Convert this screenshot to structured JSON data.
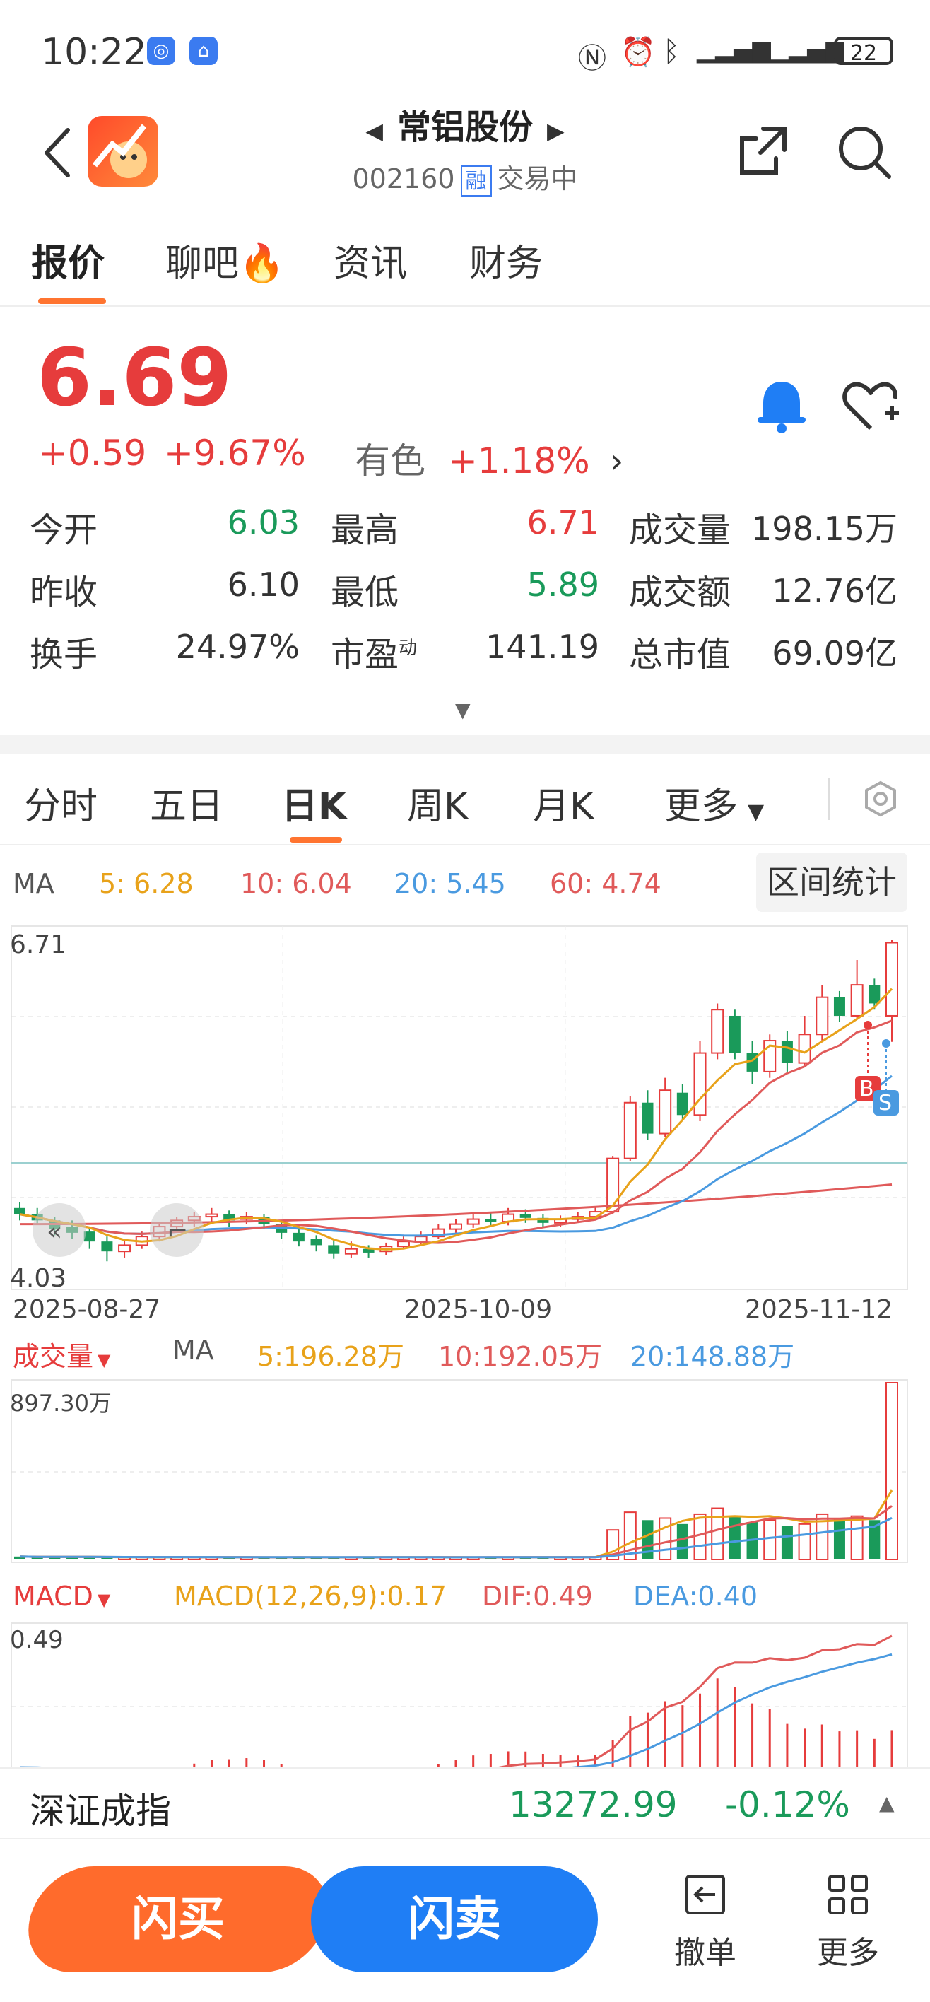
{
  "status_bar": {
    "time": "10:22",
    "battery": "22"
  },
  "header": {
    "title": "常铝股份",
    "code": "002160",
    "rong": "融",
    "status": "交易中"
  },
  "main_tabs": [
    {
      "label": "报价"
    },
    {
      "label": "聊吧"
    },
    {
      "label": "资讯"
    },
    {
      "label": "财务"
    }
  ],
  "quote": {
    "price": "6.69",
    "change": "+0.59",
    "change_pct": "+9.67%",
    "sector_name": "有色",
    "sector_pct": "+1.18%",
    "rows": [
      [
        {
          "label": "今开",
          "value": "6.03",
          "color": "green"
        },
        {
          "label": "最高",
          "value": "6.71",
          "color": "red"
        },
        {
          "label": "成交量",
          "value": "198.15万",
          "color": "dark"
        }
      ],
      [
        {
          "label": "昨收",
          "value": "6.10",
          "color": "dark"
        },
        {
          "label": "最低",
          "value": "5.89",
          "color": "green"
        },
        {
          "label": "成交额",
          "value": "12.76亿",
          "color": "dark"
        }
      ],
      [
        {
          "label": "换手",
          "value": "24.97%",
          "color": "dark"
        },
        {
          "label": "市盈",
          "sup": "动",
          "value": "141.19",
          "color": "dark"
        },
        {
          "label": "总市值",
          "value": "69.09亿",
          "color": "dark"
        }
      ]
    ]
  },
  "chart_tabs": [
    {
      "label": "分时"
    },
    {
      "label": "五日"
    },
    {
      "label": "日K"
    },
    {
      "label": "周K"
    },
    {
      "label": "月K"
    },
    {
      "label": "更多"
    }
  ],
  "ma_legend": {
    "ma": "MA",
    "ma5": "5:  6.28",
    "ma10": "10:  6.04",
    "ma20": "20:  5.45",
    "ma60": "60:  4.74"
  },
  "interval_stats": "区间统计",
  "kline": {
    "top_label": "6.71",
    "bottom_label": "4.03",
    "dates": [
      "2025-08-27",
      "2025-10-09",
      "2025-11-12"
    ],
    "marker_b": "B",
    "marker_s": "S"
  },
  "volume_legend": {
    "label": "成交量",
    "ma": "MA",
    "ma5": "5:196.28万",
    "ma10": "10:192.05万",
    "ma20": "20:148.88万",
    "top_label": "897.30万"
  },
  "macd_legend": {
    "label": "MACD",
    "macd": "MACD(12,26,9):0.17",
    "dif": "DIF:0.49",
    "dea": "DEA:0.40",
    "top_label": "0.49"
  },
  "index_bar": {
    "name": "深证成指",
    "value": "13272.99",
    "pct": "-0.12%"
  },
  "actions": {
    "buy": "闪买",
    "sell": "闪卖",
    "cancel": "撤单",
    "more": "更多"
  },
  "colors": {
    "up": "#e63c3c",
    "down": "#1a9a5a",
    "accent": "#ff7430",
    "blue": "#1f7ef5",
    "ma5": "#e8a21a",
    "ma10": "#e05a5a",
    "ma20": "#4a9ae0",
    "ma60": "#e05a5a"
  },
  "chart_data": [
    {
      "type": "candlestick",
      "title": "日K",
      "x_labels": [
        "2025-08-27",
        "2025-10-09",
        "2025-11-12"
      ],
      "ylim": [
        4.03,
        6.71
      ],
      "candles": [
        [
          4.55,
          4.5,
          4.6,
          4.45
        ],
        [
          4.5,
          4.45,
          4.55,
          4.42
        ],
        [
          4.45,
          4.38,
          4.48,
          4.33
        ],
        [
          4.4,
          4.35,
          4.45,
          4.3
        ],
        [
          4.36,
          4.28,
          4.4,
          4.22
        ],
        [
          4.28,
          4.2,
          4.32,
          4.12
        ],
        [
          4.2,
          4.25,
          4.3,
          4.15
        ],
        [
          4.25,
          4.32,
          4.36,
          4.22
        ],
        [
          4.32,
          4.4,
          4.44,
          4.28
        ],
        [
          4.4,
          4.45,
          4.48,
          4.36
        ],
        [
          4.45,
          4.48,
          4.52,
          4.4
        ],
        [
          4.48,
          4.5,
          4.55,
          4.44
        ],
        [
          4.5,
          4.45,
          4.53,
          4.4
        ],
        [
          4.46,
          4.48,
          4.52,
          4.42
        ],
        [
          4.48,
          4.42,
          4.5,
          4.38
        ],
        [
          4.42,
          4.35,
          4.45,
          4.3
        ],
        [
          4.35,
          4.28,
          4.38,
          4.24
        ],
        [
          4.3,
          4.25,
          4.33,
          4.2
        ],
        [
          4.25,
          4.18,
          4.3,
          4.14
        ],
        [
          4.18,
          4.22,
          4.28,
          4.15
        ],
        [
          4.22,
          4.19,
          4.25,
          4.15
        ],
        [
          4.2,
          4.24,
          4.27,
          4.17
        ],
        [
          4.24,
          4.28,
          4.32,
          4.22
        ],
        [
          4.28,
          4.32,
          4.36,
          4.25
        ],
        [
          4.32,
          4.38,
          4.42,
          4.3
        ],
        [
          4.38,
          4.42,
          4.46,
          4.35
        ],
        [
          4.42,
          4.46,
          4.5,
          4.39
        ],
        [
          4.46,
          4.44,
          4.52,
          4.4
        ],
        [
          4.44,
          4.5,
          4.55,
          4.41
        ],
        [
          4.5,
          4.47,
          4.54,
          4.43
        ],
        [
          4.47,
          4.43,
          4.5,
          4.4
        ],
        [
          4.43,
          4.46,
          4.49,
          4.4
        ],
        [
          4.46,
          4.48,
          4.52,
          4.43
        ],
        [
          4.48,
          4.52,
          4.56,
          4.45
        ],
        [
          4.52,
          4.95,
          4.97,
          4.5
        ],
        [
          4.95,
          5.4,
          5.45,
          4.93
        ],
        [
          5.4,
          5.15,
          5.5,
          5.1
        ],
        [
          5.15,
          5.5,
          5.6,
          5.12
        ],
        [
          5.48,
          5.3,
          5.55,
          5.25
        ],
        [
          5.3,
          5.8,
          5.9,
          5.25
        ],
        [
          5.8,
          6.15,
          6.2,
          5.75
        ],
        [
          6.1,
          5.8,
          6.15,
          5.75
        ],
        [
          5.8,
          5.65,
          5.9,
          5.55
        ],
        [
          5.65,
          5.9,
          5.95,
          5.6
        ],
        [
          5.9,
          5.72,
          5.98,
          5.65
        ],
        [
          5.72,
          5.95,
          6.1,
          5.7
        ],
        [
          5.95,
          6.25,
          6.35,
          5.9
        ],
        [
          6.25,
          6.1,
          6.3,
          6.05
        ],
        [
          6.1,
          6.35,
          6.55,
          6.08
        ],
        [
          6.35,
          6.2,
          6.4,
          6.15
        ],
        [
          6.1,
          6.69,
          6.71,
          5.89
        ]
      ],
      "ma5": 6.28,
      "ma10": 6.04,
      "ma20": 5.45,
      "ma60": 4.74
    },
    {
      "type": "bar",
      "title": "成交量",
      "ylim": [
        0,
        897.3
      ],
      "values": [
        15,
        12,
        14,
        13,
        12,
        11,
        10,
        12,
        11,
        13,
        12,
        11,
        10,
        12,
        11,
        10,
        12,
        11,
        10,
        12,
        11,
        13,
        12,
        11,
        12,
        10,
        11,
        12,
        11,
        13,
        12,
        11,
        12,
        14,
        150,
        240,
        200,
        210,
        180,
        230,
        260,
        220,
        190,
        200,
        170,
        180,
        230,
        210,
        220,
        200,
        897.3
      ],
      "ma5": 196.28,
      "ma10": 192.05,
      "ma20": 148.88
    },
    {
      "type": "bar",
      "title": "MACD",
      "series": [
        {
          "name": "DIF",
          "value": 0.49
        },
        {
          "name": "DEA",
          "value": 0.4
        },
        {
          "name": "MACD",
          "value": 0.17
        }
      ],
      "top_label": "0.49"
    }
  ]
}
